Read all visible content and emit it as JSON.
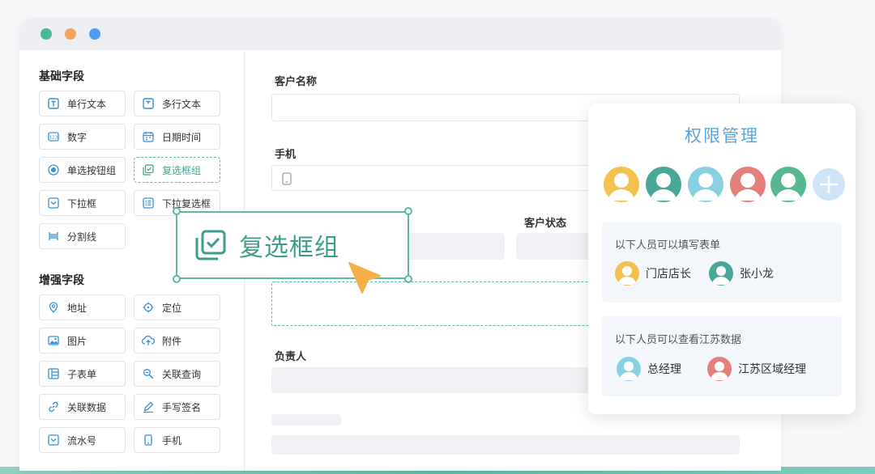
{
  "window": {
    "dots": [
      "#4cb59c",
      "#f2a55a",
      "#4f9ef0"
    ]
  },
  "sidebar": {
    "basic_title": "基础字段",
    "basic_fields": [
      {
        "label": "单行文本",
        "icon": "single-line-text-icon"
      },
      {
        "label": "多行文本",
        "icon": "multi-line-text-icon"
      },
      {
        "label": "数字",
        "icon": "number-icon"
      },
      {
        "label": "日期时间",
        "icon": "calendar-icon"
      },
      {
        "label": "单选按钮组",
        "icon": "radio-icon"
      },
      {
        "label": "复选框组",
        "icon": "checkbox-icon"
      },
      {
        "label": "下拉框",
        "icon": "dropdown-icon"
      },
      {
        "label": "下拉复选框",
        "icon": "dropdown-multi-icon"
      },
      {
        "label": "分割线",
        "icon": "divider-icon"
      }
    ],
    "advanced_title": "增强字段",
    "advanced_fields": [
      {
        "label": "地址",
        "icon": "location-pin-icon"
      },
      {
        "label": "定位",
        "icon": "crosshair-icon"
      },
      {
        "label": "图片",
        "icon": "image-icon"
      },
      {
        "label": "附件",
        "icon": "upload-cloud-icon"
      },
      {
        "label": "子表单",
        "icon": "subform-icon"
      },
      {
        "label": "关联查询",
        "icon": "linked-query-icon"
      },
      {
        "label": "关联数据",
        "icon": "linked-data-icon"
      },
      {
        "label": "手写签名",
        "icon": "pen-icon"
      },
      {
        "label": "流水号",
        "icon": "serial-number-icon"
      },
      {
        "label": "手机",
        "icon": "phone-icon"
      }
    ]
  },
  "form": {
    "customer_name_label": "客户名称",
    "phone_label": "手机",
    "customer_status_label": "客户状态",
    "owner_label": "负责人"
  },
  "drag_item": {
    "label": "复选框组",
    "icon": "checkbox-icon"
  },
  "permissions": {
    "title": "权限管理",
    "avatar_colors": [
      "#f2c14e",
      "#4aa89a",
      "#89d0e3",
      "#e47f7b",
      "#56b88f"
    ],
    "add_icon": "plus-icon",
    "fill_caption": "以下人员可以填写表单",
    "fill_people": [
      {
        "name": "门店店长",
        "color": "#f2c14e"
      },
      {
        "name": "张小龙",
        "color": "#4aa89a"
      }
    ],
    "view_caption": "以下人员可以查看江苏数据",
    "view_people": [
      {
        "name": "总经理",
        "color": "#89d0e3"
      },
      {
        "name": "江苏区域经理",
        "color": "#e47f7b"
      }
    ]
  }
}
